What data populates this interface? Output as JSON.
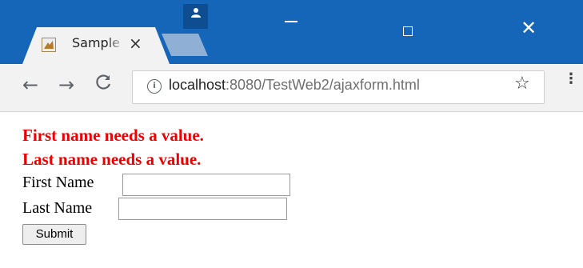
{
  "browser": {
    "tab_title": "Sample",
    "tab_close": "×",
    "address_host": "localhost",
    "address_rest": ":8080/TestWeb2/ajaxform.html",
    "nav": {
      "back": "←",
      "forward": "→",
      "reload": "C"
    },
    "menu": "⋮"
  },
  "page": {
    "errors": [
      "First name needs a value.",
      "Last name needs a value."
    ],
    "form": {
      "first_name_label": "First Name",
      "last_name_label": "Last Name",
      "first_name_value": "",
      "last_name_value": "",
      "submit_label": "Submit"
    }
  },
  "colors": {
    "titlebar": "#1565b8",
    "error": "#ee0000",
    "toolbar": "#f2f2f2"
  }
}
